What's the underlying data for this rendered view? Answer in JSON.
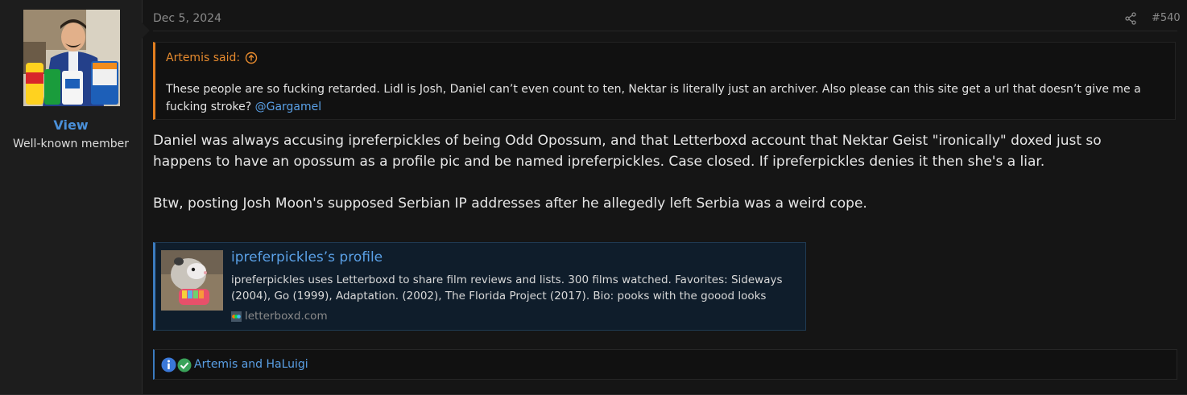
{
  "user": {
    "name": "View",
    "title": "Well-known member"
  },
  "post": {
    "date": "Dec 5, 2024",
    "number": "#540",
    "share_icon": "share-icon"
  },
  "quote": {
    "author": "Artemis said:",
    "text": "These people are so fucking retarded. Lidl is Josh, Daniel can’t even count to ten, Nektar is literally just an archiver. Also please can this site get a url that doesn’t give me a fucking stroke?",
    "mention": "@Gargamel"
  },
  "body": {
    "paragraph1": "Daniel was always accusing ipreferpickles of being Odd Opossum, and that Letterboxd account that Nektar Geist \"ironically\" doxed just so happens to have an opossum as a profile pic and be named ipreferpickles. Case closed. If ipreferpickles denies it then she's a liar.",
    "paragraph2": "Btw, posting Josh Moon's supposed Serbian IP addresses after he allegedly left Serbia was a weird cope."
  },
  "link_card": {
    "title": "ipreferpickles’s profile",
    "description": "ipreferpickles uses Letterboxd to share film reviews and lists. 300 films watched. Favorites: Sideways (2004), Go (1999), Adaptation. (2002), The Florida Project (2017). Bio: pooks with the goood looks",
    "domain": "letterboxd.com"
  },
  "reactions": {
    "users": "Artemis and HaLuigi",
    "icons": [
      "info-icon",
      "checkmark-icon"
    ]
  },
  "colors": {
    "accent_blue": "#4a90d9",
    "quote_orange": "#e68a2e",
    "background": "#151515"
  }
}
